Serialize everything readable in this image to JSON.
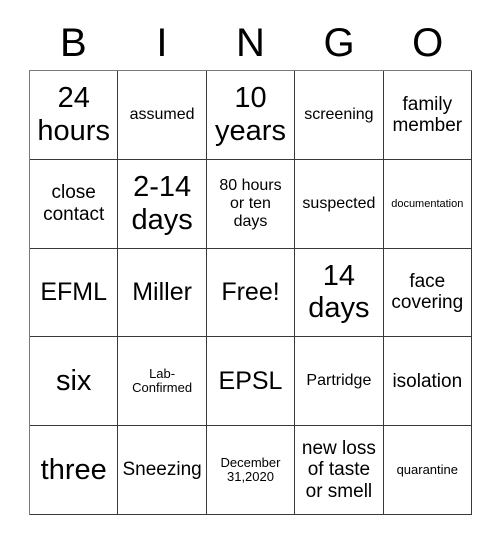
{
  "header": {
    "letters": [
      "B",
      "I",
      "N",
      "G",
      "O"
    ]
  },
  "grid": {
    "rows": [
      [
        {
          "text": "24\nhours",
          "size": "fs-xl"
        },
        {
          "text": "assumed",
          "size": "fs-sm"
        },
        {
          "text": "10\nyears",
          "size": "fs-xl"
        },
        {
          "text": "screening",
          "size": "fs-sm"
        },
        {
          "text": "family\nmember",
          "size": "fs-md"
        }
      ],
      [
        {
          "text": "close\ncontact",
          "size": "fs-md"
        },
        {
          "text": "2-14\ndays",
          "size": "fs-xl"
        },
        {
          "text": "80 hours\nor ten\ndays",
          "size": "fs-sm"
        },
        {
          "text": "suspected",
          "size": "fs-sm"
        },
        {
          "text": "documentation",
          "size": "fs-xxs"
        }
      ],
      [
        {
          "text": "EFML",
          "size": "fs-lg"
        },
        {
          "text": "Miller",
          "size": "fs-lg"
        },
        {
          "text": "Free!",
          "size": "fs-lg"
        },
        {
          "text": "14\ndays",
          "size": "fs-xl"
        },
        {
          "text": "face\ncovering",
          "size": "fs-md"
        }
      ],
      [
        {
          "text": "six",
          "size": "fs-xl"
        },
        {
          "text": "Lab-\nConfirmed",
          "size": "fs-xs"
        },
        {
          "text": "EPSL",
          "size": "fs-lg"
        },
        {
          "text": "Partridge",
          "size": "fs-sm"
        },
        {
          "text": "isolation",
          "size": "fs-md"
        }
      ],
      [
        {
          "text": "three",
          "size": "fs-xl"
        },
        {
          "text": "Sneezing",
          "size": "fs-md"
        },
        {
          "text": "December\n31,2020",
          "size": "fs-xs"
        },
        {
          "text": "new loss\nof taste\nor smell",
          "size": "fs-md"
        },
        {
          "text": "quarantine",
          "size": "fs-xs"
        }
      ]
    ]
  },
  "colors": {
    "background": "#ffffff",
    "text": "#000000",
    "grid_line": "#3a3a3a"
  }
}
